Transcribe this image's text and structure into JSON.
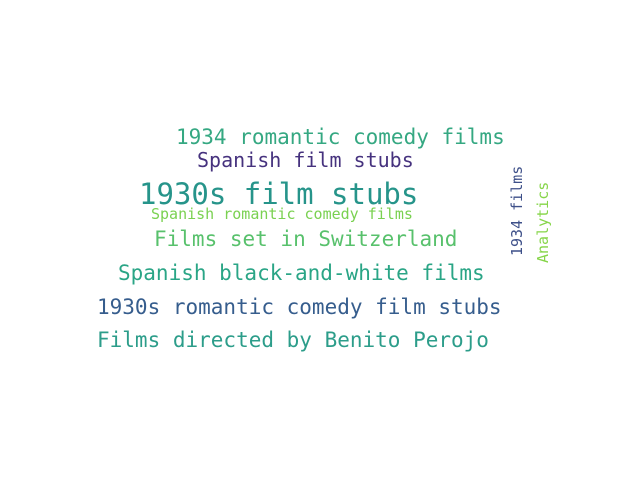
{
  "word_cloud": {
    "words": [
      {
        "text": "1934 romantic comedy films",
        "color": "#35a882"
      },
      {
        "text": "Spanish film stubs",
        "color": "#46327e"
      },
      {
        "text": "1930s film stubs",
        "color": "#26948a"
      },
      {
        "text": "Spanish romantic comedy films",
        "color": "#7ad151"
      },
      {
        "text": "Films set in Switzerland",
        "color": "#58c16c"
      },
      {
        "text": "Spanish black-and-white films",
        "color": "#2aa586"
      },
      {
        "text": "1930s romantic comedy film stubs",
        "color": "#365d8d"
      },
      {
        "text": "Films directed by Benito Perojo",
        "color": "#2c9d8a"
      },
      {
        "text": "1934 films",
        "color": "#3e5089"
      },
      {
        "text": "Analytics",
        "color": "#86d549"
      }
    ]
  }
}
